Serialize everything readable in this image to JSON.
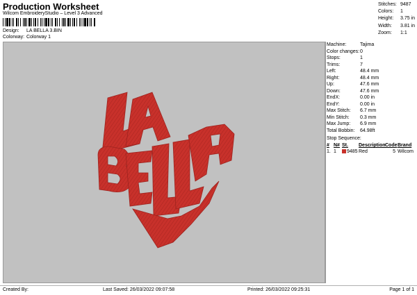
{
  "header": {
    "title": "Production Worksheet",
    "subtitle": "Wilcom EmbroideryStudio – Level 3 Advanced",
    "design_label": "Design:",
    "design_value": "LA BELLA 3.BIN",
    "colorway_label": "Colorway:",
    "colorway_value": "Colorway 1"
  },
  "summary": [
    {
      "label": "Stitches:",
      "value": "9487"
    },
    {
      "label": "Colors:",
      "value": "1"
    },
    {
      "label": "Height:",
      "value": "3.75 in"
    },
    {
      "label": "Width:",
      "value": "3.81 in"
    },
    {
      "label": "Zoom:",
      "value": "1:1"
    }
  ],
  "design": {
    "background": "#c1c1c1",
    "thread_color": "#c8312b",
    "letters": [
      "L",
      "A",
      "B",
      "E",
      "L",
      "L",
      "A"
    ]
  },
  "details": [
    {
      "label": "Machine:",
      "value": "Tajima"
    },
    {
      "label": "Color changes:",
      "value": "0"
    },
    {
      "label": "Stops:",
      "value": "1"
    },
    {
      "label": "Trims:",
      "value": "7"
    },
    {
      "label": "Left:",
      "value": "48.4 mm"
    },
    {
      "label": "Right:",
      "value": "48.4 mm"
    },
    {
      "label": "Up:",
      "value": "47.6 mm"
    },
    {
      "label": "Down:",
      "value": "47.6 mm"
    },
    {
      "label": "EndX:",
      "value": "0.00 in"
    },
    {
      "label": "EndY:",
      "value": "0.00 in"
    },
    {
      "label": "Max Stitch:",
      "value": "6.7 mm"
    },
    {
      "label": "Min Stitch:",
      "value": "0.3 mm"
    },
    {
      "label": "Max Jump:",
      "value": "6.9 mm"
    },
    {
      "label": "Total Bobbin:",
      "value": "64.98ft"
    }
  ],
  "stop_sequence": {
    "title": "Stop Sequence:",
    "columns": [
      "#",
      "N#",
      "St.",
      "Description",
      "Code",
      "Brand"
    ],
    "rows": [
      {
        "num": "1.",
        "n": "1",
        "st": "9485",
        "description": "Red",
        "code": "5",
        "brand": "Wilcom",
        "color": "#c8312b"
      }
    ]
  },
  "footer": {
    "created_by": "Created By:",
    "last_saved": "Last Saved: 26/03/2022 09:07:58",
    "printed": "Printed: 26/03/2022 09:25:31",
    "page": "Page 1 of 1"
  }
}
